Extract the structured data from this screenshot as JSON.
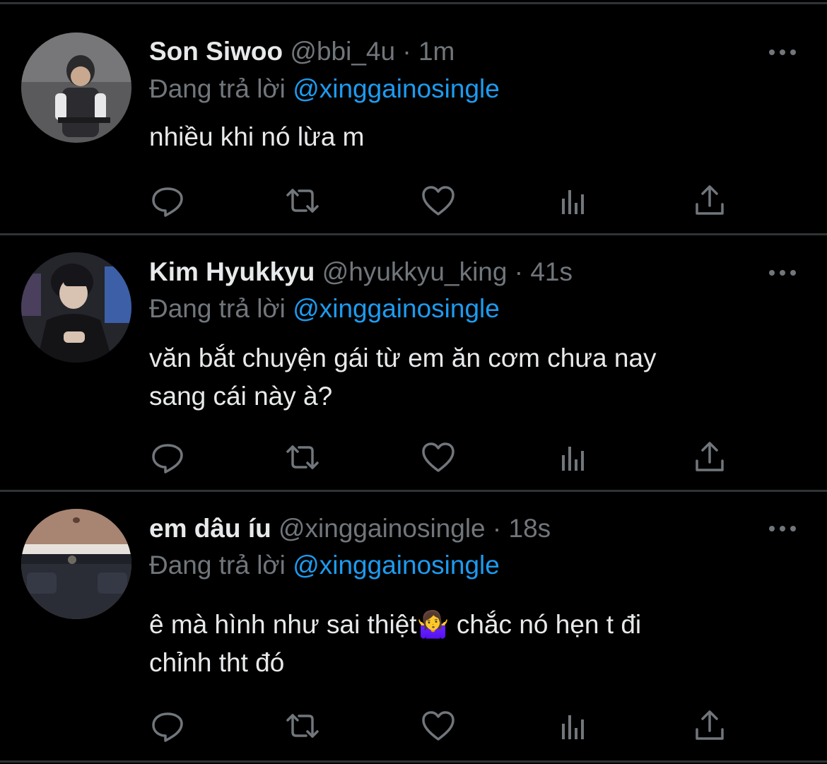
{
  "tweets": [
    {
      "name": "Son Siwoo",
      "handle": "@bbi_4u",
      "time": "1m",
      "reply_label": "Đang trả lời",
      "reply_to": "@xinggainosingle",
      "text_lines": [
        "nhiều khi nó lừa m"
      ]
    },
    {
      "name": "Kim Hyukkyu",
      "handle": "@hyukkyu_king",
      "time": "41s",
      "reply_label": "Đang trả lời",
      "reply_to": "@xinggainosingle",
      "text_lines": [
        "văn bắt chuyện gái từ em ăn cơm chưa nay",
        "sang cái này à?"
      ]
    },
    {
      "name": "em dâu íu",
      "handle": "@xinggainosingle",
      "time": "18s",
      "reply_label": "Đang trả lời",
      "reply_to": "@xinggainosingle",
      "text_lines": [
        "ê mà hình như sai thiệt🤷‍♀️ chắc nó hẹn t đi",
        "chỉnh tht đó"
      ]
    }
  ],
  "separator": "·",
  "icons": [
    "more-icon",
    "reply-icon",
    "retweet-icon",
    "like-icon",
    "views-icon",
    "share-icon"
  ],
  "colors": {
    "background": "#000000",
    "text": "#e7e9ea",
    "muted": "#71767b",
    "link": "#1d9bf0",
    "divider": "#2f3336"
  }
}
